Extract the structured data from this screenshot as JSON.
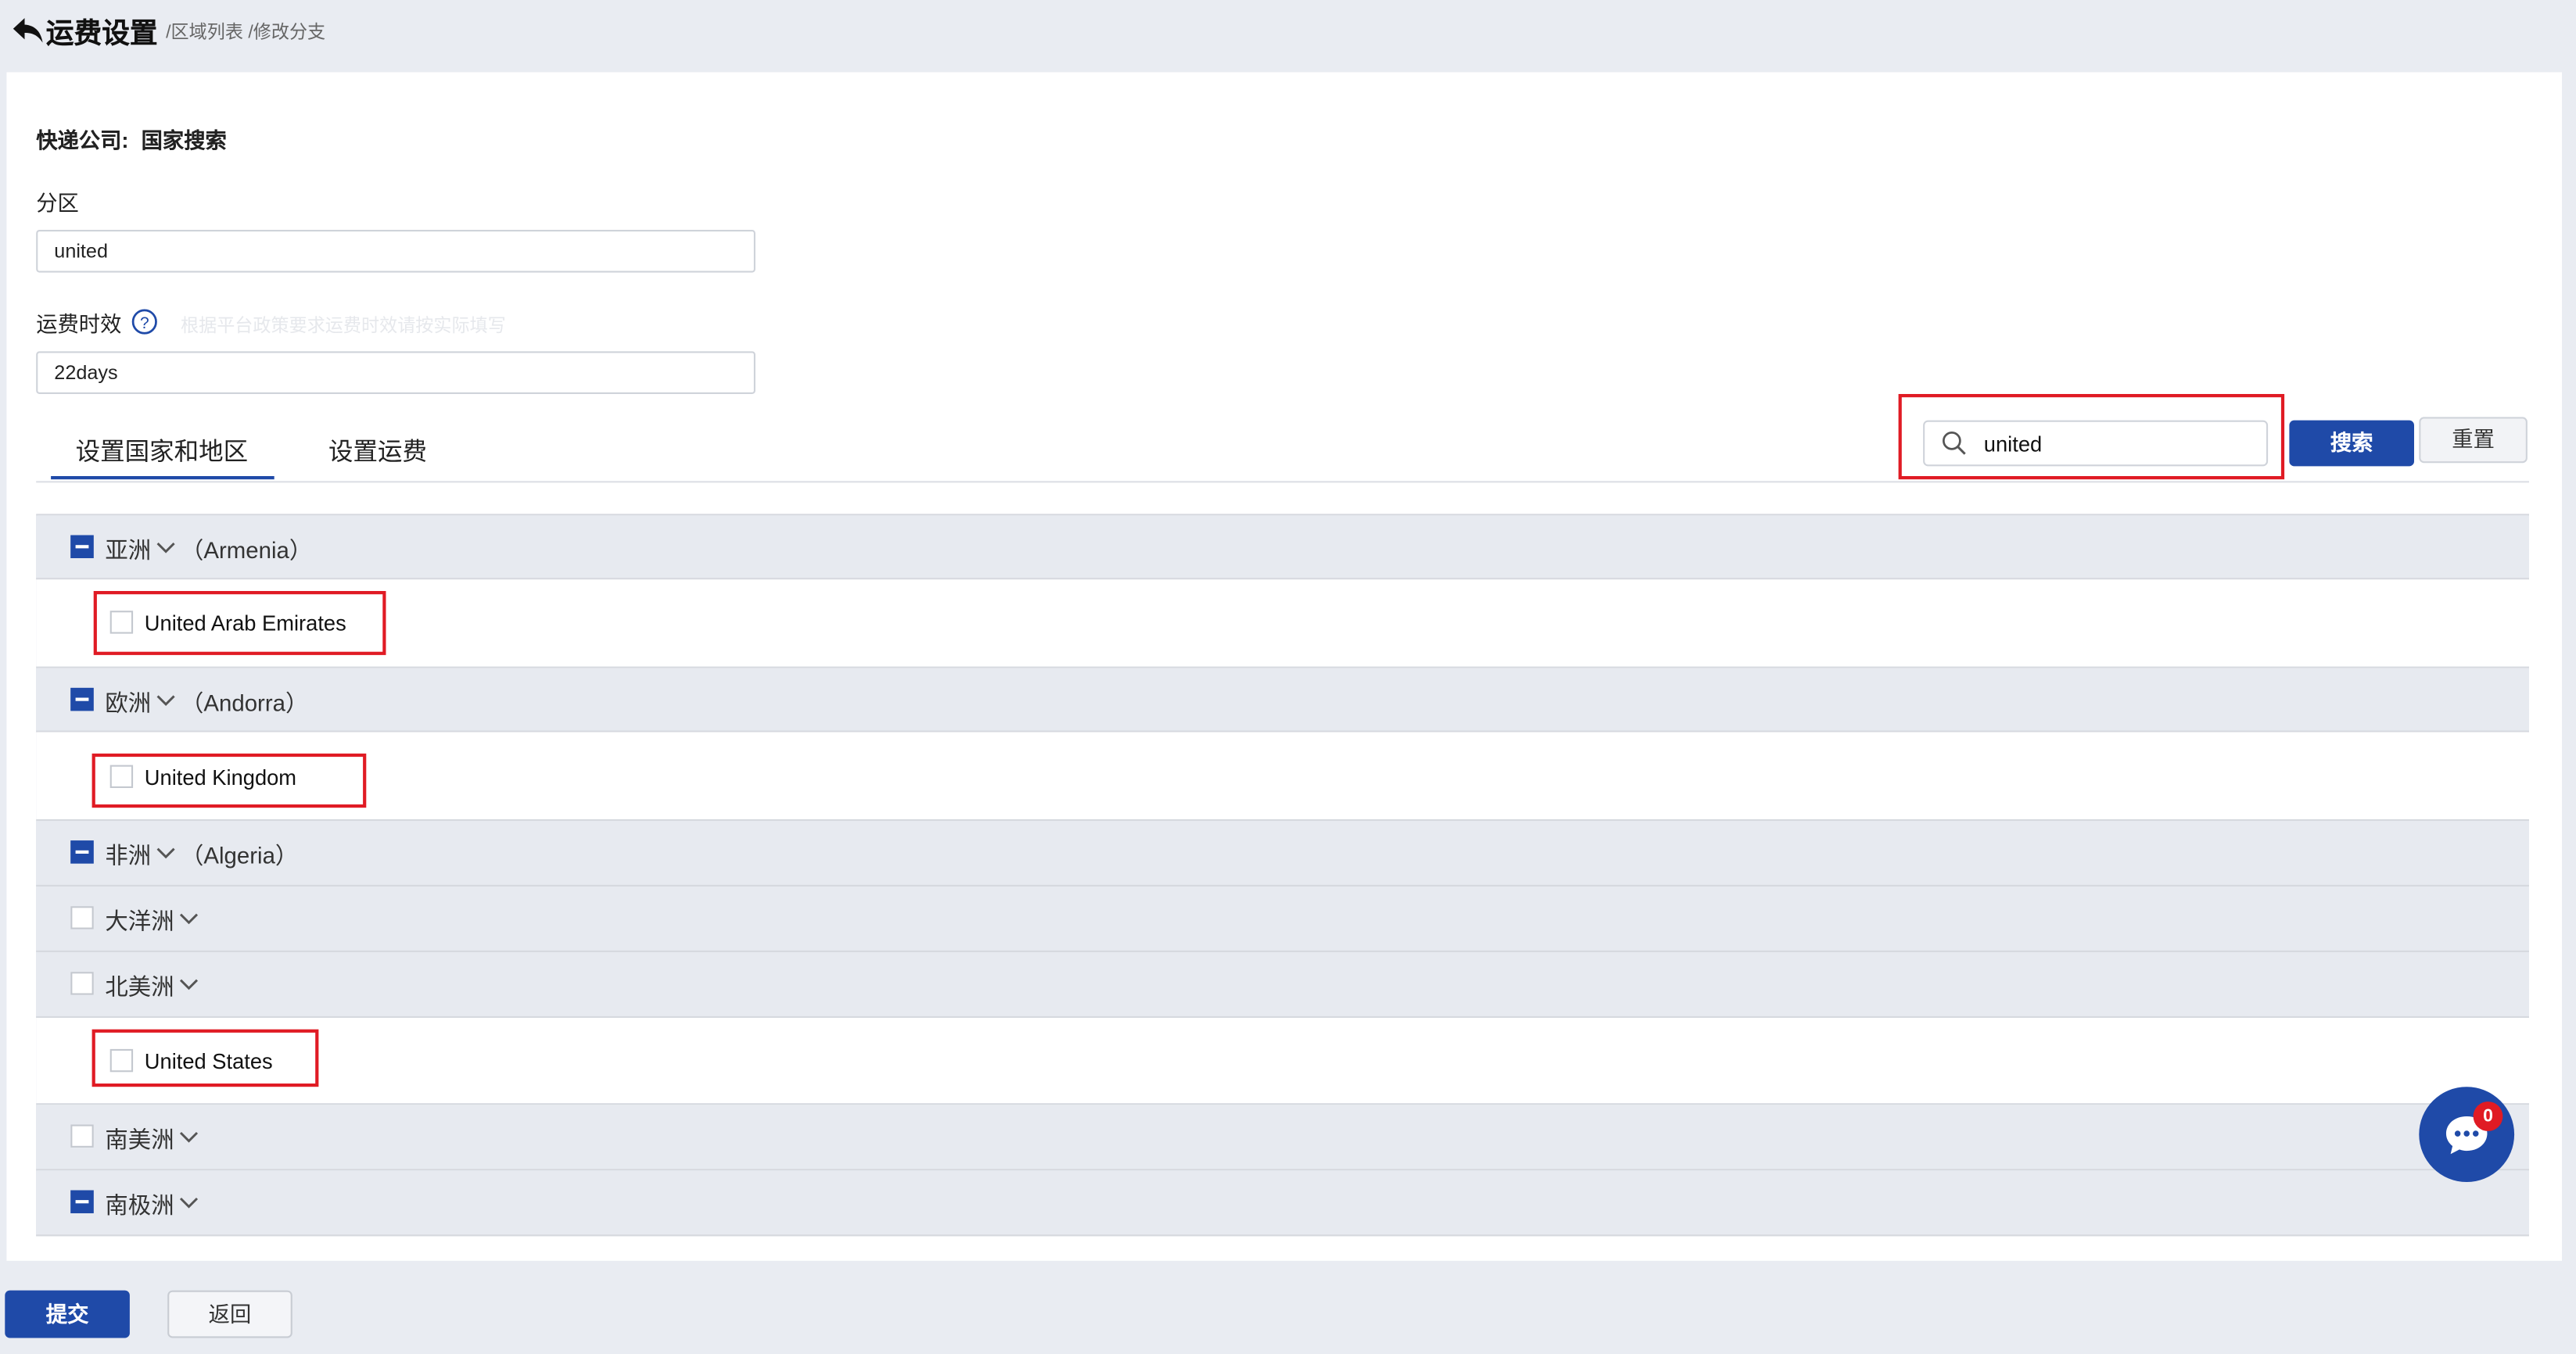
{
  "header": {
    "title": "运费设置",
    "breadcrumb": "/区域列表 /修改分支"
  },
  "form": {
    "company_label": "快递公司:",
    "company_value": "国家搜索",
    "zone_label": "分区",
    "zone_value": "united",
    "timeliness_label": "运费时效",
    "timeliness_hint": "根据平台政策要求运费时效请按实际填写",
    "timeliness_value": "22days"
  },
  "tabs": [
    {
      "label": "设置国家和地区",
      "active": true
    },
    {
      "label": "设置运费",
      "active": false
    }
  ],
  "search": {
    "value": "united",
    "search_label": "搜索",
    "reset_label": "重置"
  },
  "regions": [
    {
      "name": "亚洲",
      "extra": "（Armenia）",
      "state": "partial",
      "countries": [
        {
          "name": "United Arab Emirates",
          "checked": false
        }
      ]
    },
    {
      "name": "欧洲",
      "extra": "（Andorra）",
      "state": "partial",
      "countries": [
        {
          "name": "United Kingdom",
          "checked": false
        }
      ]
    },
    {
      "name": "非洲",
      "extra": "（Algeria）",
      "state": "partial",
      "countries": []
    },
    {
      "name": "大洋洲",
      "extra": "",
      "state": "empty",
      "countries": []
    },
    {
      "name": "北美洲",
      "extra": "",
      "state": "empty",
      "countries": [
        {
          "name": "United States",
          "checked": false
        }
      ]
    },
    {
      "name": "南美洲",
      "extra": "",
      "state": "empty",
      "countries": []
    },
    {
      "name": "南极洲",
      "extra": "",
      "state": "partial",
      "countries": []
    }
  ],
  "footer": {
    "submit_label": "提交",
    "return_label": "返回"
  },
  "chat": {
    "badge_count": "0"
  },
  "colors": {
    "primary": "#1f4aa8",
    "highlight": "#e01b24",
    "page_bg": "#e9ecf2",
    "row_bg": "#e7eaf0"
  }
}
